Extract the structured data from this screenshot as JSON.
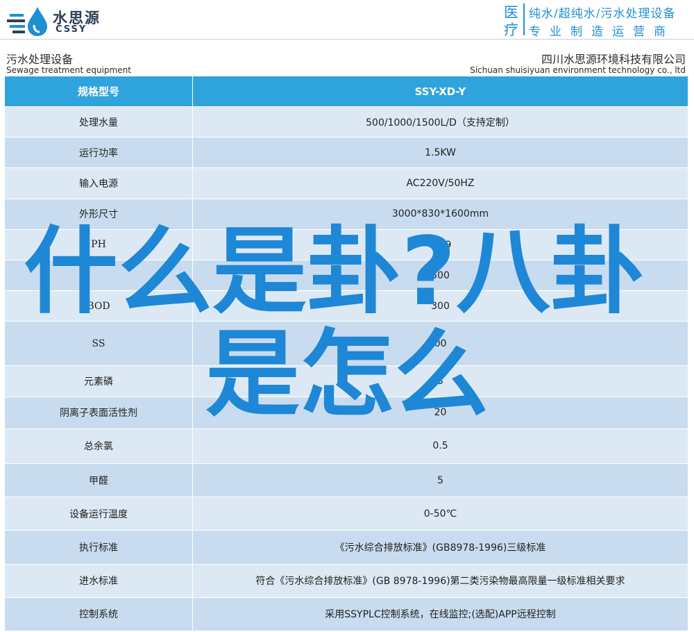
{
  "header": {
    "logo_cn": "水思源",
    "logo_en": "CSSY",
    "big_char_1": "医",
    "big_char_2": "疗",
    "tagline_1": "纯水/超纯水/污水处理设备",
    "tagline_2": "专业制造运营商",
    "colors": {
      "brand_blue": "#1f8fd4",
      "logo_dark": "#2b3f57"
    }
  },
  "subheader": {
    "left_cn": "污水处理设备",
    "left_en": "Sewage treatment equipment",
    "right_cn": "四川水思源环境科技有限公司",
    "right_en": "Sichuan shuisiyuan environment technology co., ltd"
  },
  "table": {
    "header": {
      "key": "规格型号",
      "value": "SSY-XD-Y"
    },
    "rows": [
      {
        "key": "处理水量",
        "value": "500/1000/1500L/D（支持定制）"
      },
      {
        "key": "运行功率",
        "value": "1.5KW"
      },
      {
        "key": "输入电源",
        "value": "AC220V/50HZ"
      },
      {
        "key": "外形尺寸",
        "value": "3000*830*1600mm"
      },
      {
        "key": "PH",
        "value": "6～9"
      },
      {
        "key": "",
        "value": "500"
      },
      {
        "key": "BOD",
        "value": "300"
      },
      {
        "key": "SS",
        "value": "00"
      },
      {
        "key": "元素磷",
        "value": "3"
      },
      {
        "key": "阴离子表面活性剂",
        "value": "20"
      },
      {
        "key": "总余氯",
        "value": "0.5"
      },
      {
        "key": "甲醛",
        "value": "5"
      },
      {
        "key": "设备运行温度",
        "value": "0-50℃"
      },
      {
        "key": "执行标准",
        "value": "《污水综合排放标准》(GB8978-1996)三级标准"
      },
      {
        "key": "进水标准",
        "value": "符合《污水综合排放标准》(GB 8978-1996)第二类污染物最高限量一级标准相关要求"
      },
      {
        "key": "控制系统",
        "value": "采用SSYPLC控制系统，在线监控;(选配)APP远程控制"
      }
    ],
    "colors": {
      "header_bg": "#2fa3db",
      "row_light": "#dce9f5",
      "row_dark": "#c9dcef"
    }
  },
  "overlay": {
    "line1": "什么是卦?八卦",
    "line2": "是怎么",
    "color": "#1e87d6"
  }
}
